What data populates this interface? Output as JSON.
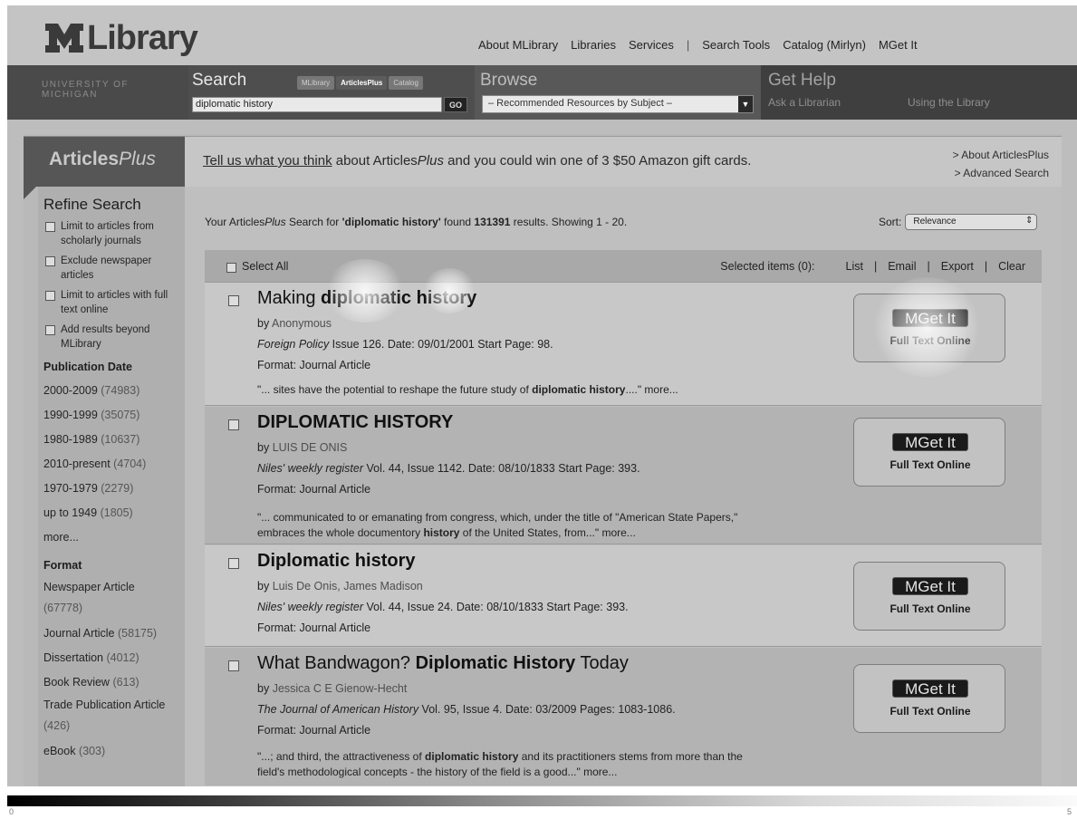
{
  "header": {
    "logo_text": "Library",
    "nav": [
      "About MLibrary",
      "Libraries",
      "Services",
      "|",
      "Search Tools",
      "Catalog (Mirlyn)",
      "MGet It"
    ]
  },
  "navbar": {
    "university": "UNIVERSITY OF MICHIGAN",
    "search": {
      "title": "Search",
      "tabs": [
        "MLibrary",
        "ArticlesPlus",
        "Catalog"
      ],
      "active_tab": "ArticlesPlus",
      "query": "diplomatic history",
      "go_label": "GO"
    },
    "browse": {
      "title": "Browse",
      "selected": "– Recommended Resources by Subject –"
    },
    "help": {
      "title": "Get Help",
      "links": [
        "Ask a Librarian",
        "Using the Library"
      ]
    }
  },
  "articles_tab": {
    "label_main": "Articles",
    "label_italic": "Plus"
  },
  "banner": {
    "link_text": "Tell us what you think",
    "text_pre": " about Articles",
    "text_italic": "Plus",
    "text_post": " and you could win one of 3 $50 Amazon gift cards.",
    "links": [
      "> About ArticlesPlus",
      "> Advanced Search"
    ]
  },
  "sidebar": {
    "heading": "Refine Search",
    "limits": [
      "Limit to articles from scholarly journals",
      "Exclude newspaper articles",
      "Limit to articles with full text online",
      "Add results beyond MLibrary"
    ],
    "pubdate_heading": "Publication Date",
    "pubdate": [
      {
        "label": "2000-2009",
        "count": "(74983)"
      },
      {
        "label": "1990-1999",
        "count": "(35075)"
      },
      {
        "label": "1980-1989",
        "count": "(10637)"
      },
      {
        "label": "2010-present",
        "count": "(4704)"
      },
      {
        "label": "1970-1979",
        "count": "(2279)"
      },
      {
        "label": "up to 1949",
        "count": "(1805)"
      }
    ],
    "more": "more...",
    "format_heading": "Format",
    "formats": [
      {
        "label": "Newspaper Article",
        "count": "(67778)"
      },
      {
        "label": "Journal Article",
        "count": "(58175)"
      },
      {
        "label": "Dissertation",
        "count": "(4012)"
      },
      {
        "label": "Book Review",
        "count": "(613)"
      },
      {
        "label": "Trade Publication Article",
        "count": "(426)"
      },
      {
        "label": "eBook",
        "count": "(303)"
      }
    ]
  },
  "results": {
    "summary_pre": "Your Articles",
    "summary_italic": "Plus",
    "summary_mid": " Search for ",
    "summary_query": "'diplomatic history'",
    "summary_found": " found ",
    "summary_count": "131391",
    "summary_post": " results. Showing 1 - 20.",
    "sort_label": "Sort:",
    "sort_value": "Relevance",
    "select_all": "Select All",
    "selected_items": "Selected items (0):",
    "actions": [
      "List",
      "|",
      "Email",
      "|",
      "Export",
      "|",
      "Clear"
    ],
    "getit_label": "Get It",
    "getit_caption": "Full Text Online",
    "items": [
      {
        "title_a": "Making ",
        "title_b": "diplomatic history",
        "title_c": "",
        "by": "by ",
        "authors": "Anonymous",
        "source_italic": "Foreign Policy",
        "source_rest": " Issue 126. Date: 09/01/2001 Start Page: 98.",
        "format": "Format: Journal Article",
        "snippet_a": "\"... sites have the potential to reshape the future study of ",
        "snippet_b": "diplomatic history",
        "snippet_c": "....\" more..."
      },
      {
        "title_a": "",
        "title_b": "DIPLOMATIC HISTORY",
        "title_c": "",
        "by": "by ",
        "authors": "LUIS DE ONIS",
        "source_italic": "Niles' weekly register",
        "source_rest": " Vol. 44, Issue 1142. Date: 08/10/1833 Start Page: 393.",
        "format": "Format: Journal Article",
        "snippet_a": "\"... communicated to or emanating from congress, which, under the title of \"American State Papers,\" embraces the whole documentory ",
        "snippet_b": "history",
        "snippet_c": " of the United States, from...\" more..."
      },
      {
        "title_a": "",
        "title_b": "Diplomatic history",
        "title_c": "",
        "by": "by ",
        "authors": "Luis De Onis, James Madison",
        "source_italic": "Niles' weekly register",
        "source_rest": " Vol. 44, Issue 24. Date: 08/10/1833 Start Page: 393.",
        "format": "Format: Journal Article",
        "snippet_a": "",
        "snippet_b": "",
        "snippet_c": ""
      },
      {
        "title_a": "What Bandwagon? ",
        "title_b": "Diplomatic History",
        "title_c": " Today",
        "by": "by ",
        "authors": "Jessica C E Gienow-Hecht",
        "source_italic": "The Journal of American History",
        "source_rest": " Vol. 95, Issue 4. Date: 03/2009 Pages: 1083-1086.",
        "format": "Format: Journal Article",
        "snippet_a": "\"...; and third, the attractiveness of ",
        "snippet_b": "diplomatic history",
        "snippet_c": " and its practitioners stems from more than the field's methodological concepts - the history of the field is a good...\" more..."
      }
    ]
  },
  "scale": {
    "min": "0",
    "max": "5"
  }
}
